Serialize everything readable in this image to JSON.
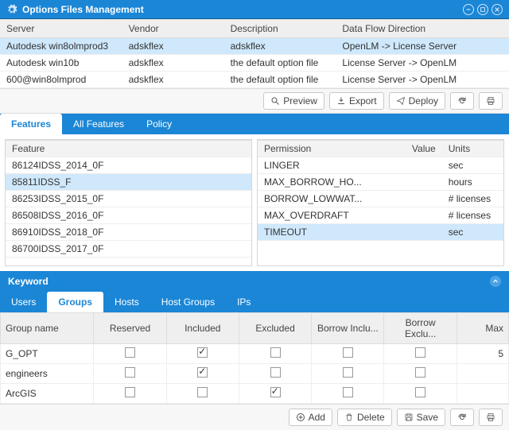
{
  "titlebar": {
    "title": "Options Files Management"
  },
  "topgrid": {
    "headers": [
      "Server",
      "Vendor",
      "Description",
      "Data Flow Direction"
    ],
    "rows": [
      {
        "server": "Autodesk win8olmprod3",
        "vendor": "adskflex",
        "desc": "adskflex",
        "flow": "OpenLM -> License Server",
        "sel": true
      },
      {
        "server": "Autodesk win10b",
        "vendor": "adskflex",
        "desc": "the default option file",
        "flow": "License Server -> OpenLM",
        "sel": false
      },
      {
        "server": "600@win8olmprod",
        "vendor": "adskflex",
        "desc": "the default option file",
        "flow": "License Server -> OpenLM",
        "sel": false
      }
    ]
  },
  "toolbar": {
    "preview": "Preview",
    "export": "Export",
    "deploy": "Deploy"
  },
  "tabs1": [
    "Features",
    "All Features",
    "Policy"
  ],
  "featuresHeader": "Feature",
  "features": [
    {
      "name": "86124IDSS_2014_0F",
      "sel": false
    },
    {
      "name": "85811IDSS_F",
      "sel": true
    },
    {
      "name": "86253IDSS_2015_0F",
      "sel": false
    },
    {
      "name": "86508IDSS_2016_0F",
      "sel": false
    },
    {
      "name": "86910IDSS_2018_0F",
      "sel": false
    },
    {
      "name": "86700IDSS_2017_0F",
      "sel": false
    }
  ],
  "permHeaders": [
    "Permission",
    "Value",
    "Units"
  ],
  "permissions": [
    {
      "perm": "LINGER",
      "value": "",
      "units": "sec",
      "sel": false
    },
    {
      "perm": "MAX_BORROW_HO...",
      "value": "",
      "units": "hours",
      "sel": false
    },
    {
      "perm": "BORROW_LOWWAT...",
      "value": "",
      "units": "# licenses",
      "sel": false
    },
    {
      "perm": "MAX_OVERDRAFT",
      "value": "",
      "units": "# licenses",
      "sel": false
    },
    {
      "perm": "TIMEOUT",
      "value": "",
      "units": "sec",
      "sel": true
    }
  ],
  "keywordSection": "Keyword",
  "tabs2": [
    "Users",
    "Groups",
    "Hosts",
    "Host Groups",
    "IPs"
  ],
  "lowerHeaders": [
    "Group name",
    "Reserved",
    "Included",
    "Excluded",
    "Borrow Inclu...",
    "Borrow Exclu...",
    "Max"
  ],
  "lowerRows": [
    {
      "name": "G_OPT",
      "reserved": false,
      "included": true,
      "excluded": false,
      "binc": false,
      "bexc": false,
      "max": "5"
    },
    {
      "name": "engineers",
      "reserved": false,
      "included": true,
      "excluded": false,
      "binc": false,
      "bexc": false,
      "max": ""
    },
    {
      "name": "ArcGIS",
      "reserved": false,
      "included": false,
      "excluded": true,
      "binc": false,
      "bexc": false,
      "max": ""
    }
  ],
  "bottomToolbar": {
    "add": "Add",
    "delete": "Delete",
    "save": "Save"
  }
}
